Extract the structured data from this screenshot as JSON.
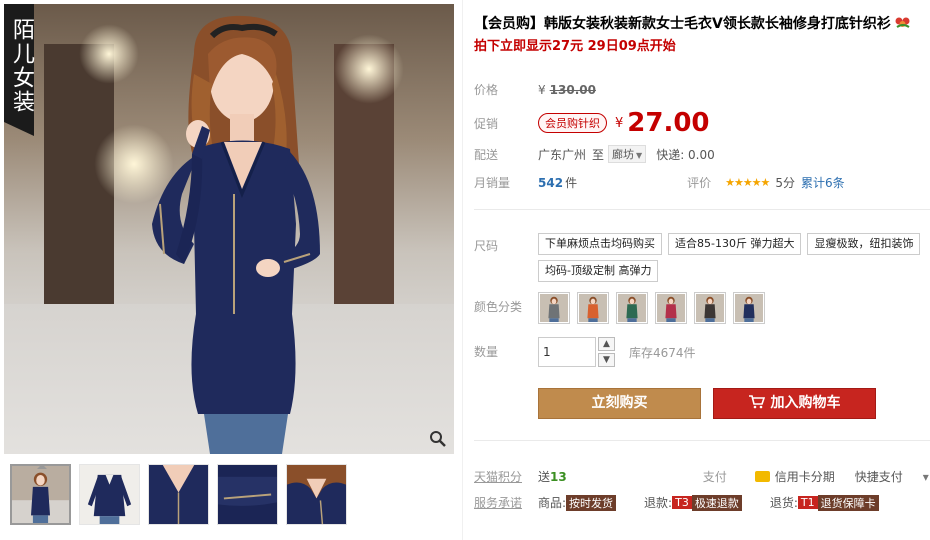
{
  "brand_tag": "陌儿女装",
  "title": "【会员购】韩版女装秋装新款女士毛衣V领长款长袖修身打底针织衫",
  "subtitle": "拍下立即显示27元 29日09点开始",
  "price": {
    "label": "价格",
    "currency": "¥",
    "value": "130.00"
  },
  "promo": {
    "label": "促销",
    "tag": "会员购针织",
    "currency": "¥",
    "value": "27.00"
  },
  "delivery": {
    "label": "配送",
    "from": "广东广州",
    "to_word": "至",
    "city": "廊坊",
    "express": "快递: 0.00"
  },
  "sales": {
    "label": "月销量",
    "count": "542",
    "unit": "件",
    "rating_label": "评价",
    "stars": "★★★★★",
    "score": "5分",
    "reviews": "累计6条"
  },
  "size": {
    "label": "尺码",
    "options": [
      "下单麻烦点击均码购买",
      "适合85-130斤 弹力超大",
      "显瘦极致，纽扣装饰",
      "均码-顶级定制 高弹力"
    ]
  },
  "color": {
    "label": "颜色分类",
    "swatches": [
      {
        "name": "grey",
        "color": "#6f7376"
      },
      {
        "name": "orange",
        "color": "#d8612f"
      },
      {
        "name": "green",
        "color": "#2d6a52"
      },
      {
        "name": "rose",
        "color": "#b3304a"
      },
      {
        "name": "brown",
        "color": "#3d3735"
      },
      {
        "name": "navy",
        "color": "#22305e"
      }
    ]
  },
  "quantity": {
    "label": "数量",
    "value": "1",
    "stock": "库存4674件"
  },
  "buttons": {
    "buy_now": "立刻购买",
    "add_cart": "加入购物车"
  },
  "points": {
    "label": "天猫积分",
    "text_prefix": "送",
    "value": "13",
    "pay_label": "支付",
    "credit": "信用卡分期",
    "quick_pay": "快捷支付",
    "caret": "▾"
  },
  "service": {
    "label": "服务承诺",
    "goods_prefix": "商品:",
    "goods_tag": "按时发货",
    "refund_prefix": "退款:",
    "refund_code": "T3",
    "refund_tag": "极速退款",
    "return_prefix": "退货:",
    "return_code": "T1",
    "return_tag": "退货保障卡"
  },
  "colors": {
    "price_red": "#c40000",
    "buy_button": "#c08b4d",
    "cart_button": "#c7251f",
    "sales_blue": "#2d6fb0",
    "star_gold": "#f5a500",
    "model_sweater": "#1f2a5c"
  },
  "icons": {
    "zoom": "magnifier-icon",
    "cart": "shopping-cart-icon",
    "flower": "flower-icon",
    "credit": "credit-card-icon"
  }
}
